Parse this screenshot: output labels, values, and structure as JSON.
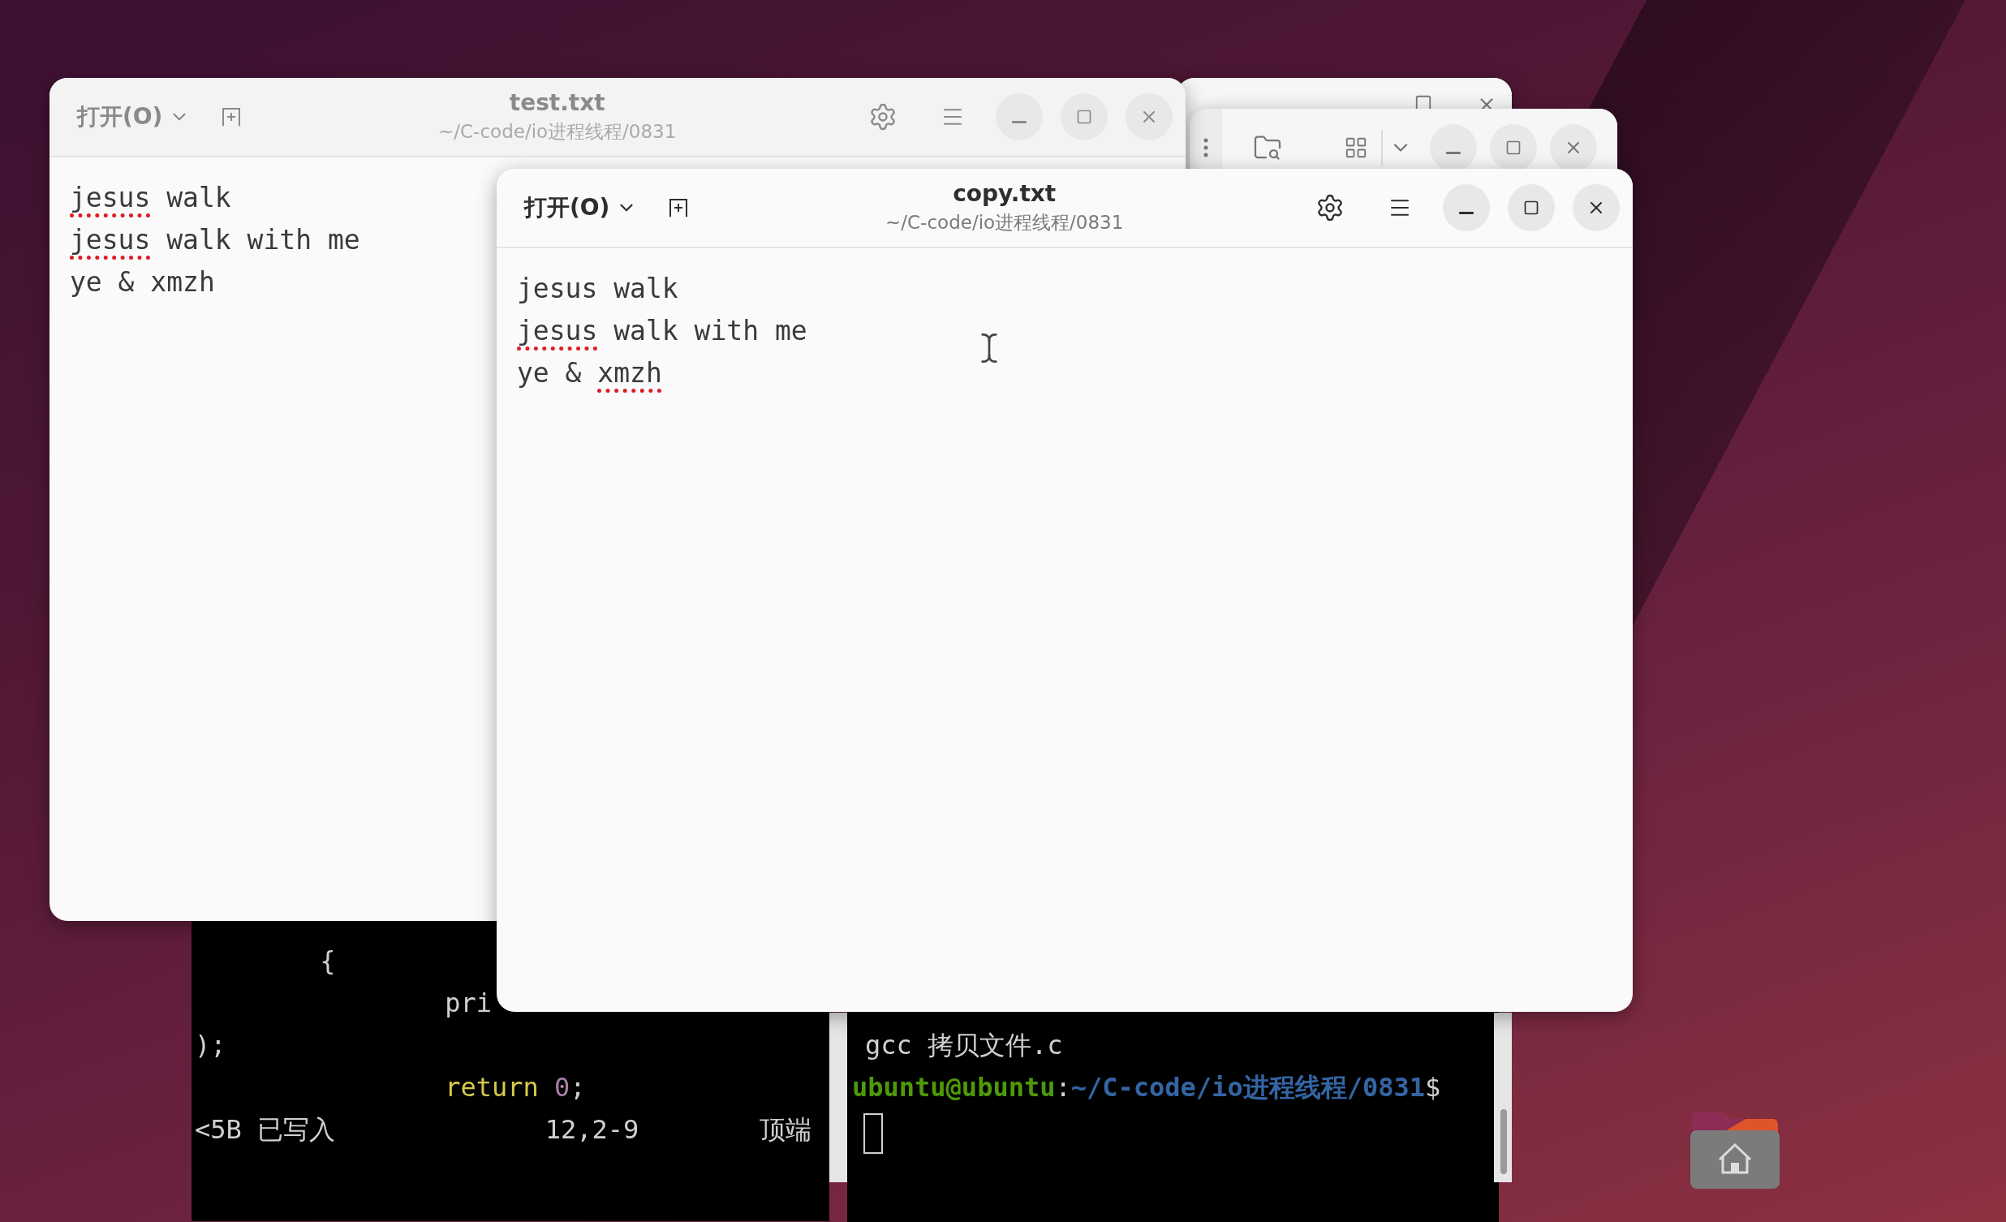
{
  "editors": [
    {
      "open_button": "打开(O)",
      "title": "test.txt",
      "subtitle": "~/C-code/io进程线程/0831",
      "active": false,
      "lines": [
        {
          "segments": [
            {
              "text": "jesus",
              "misspelled": true
            },
            {
              "text": " walk",
              "misspelled": false
            }
          ]
        },
        {
          "segments": [
            {
              "text": "jesus",
              "misspelled": true
            },
            {
              "text": " walk with me",
              "misspelled": false
            }
          ]
        },
        {
          "segments": [
            {
              "text": "ye & xmzh",
              "misspelled": false
            }
          ]
        }
      ]
    },
    {
      "open_button": "打开(O)",
      "title": "copy.txt",
      "subtitle": "~/C-code/io进程线程/0831",
      "active": true,
      "lines": [
        {
          "segments": [
            {
              "text": "jesus walk",
              "misspelled": false
            }
          ]
        },
        {
          "segments": [
            {
              "text": "jesus",
              "misspelled": true
            },
            {
              "text": " walk with me",
              "misspelled": false
            }
          ]
        },
        {
          "segments": [
            {
              "text": "ye & ",
              "misspelled": false
            },
            {
              "text": "xmzh",
              "misspelled": true
            }
          ]
        }
      ]
    }
  ],
  "vim_terminal": {
    "lines": [
      {
        "segments": [
          {
            "text": "        {",
            "kind": "plain"
          }
        ]
      },
      {
        "segments": [
          {
            "text": "                pri",
            "kind": "plain"
          }
        ]
      },
      {
        "segments": [
          {
            "text": ");",
            "kind": "plain"
          }
        ]
      },
      {
        "segments": [
          {
            "text": "                return",
            "kind": "keyword"
          },
          {
            "text": "0",
            "kind": "number"
          },
          {
            "text": ";",
            "kind": "plain"
          }
        ]
      }
    ],
    "status": {
      "message": "<5B 已写入",
      "position": "12,2-9",
      "scroll": "顶端"
    }
  },
  "shell_terminal": {
    "lines": [
      "gcc 拷贝文件.c"
    ],
    "prompt": {
      "user": "ubuntu@ubuntu",
      "separator": ":",
      "path": "~/C-code/io进程线程/0831",
      "symbol": "$"
    }
  }
}
